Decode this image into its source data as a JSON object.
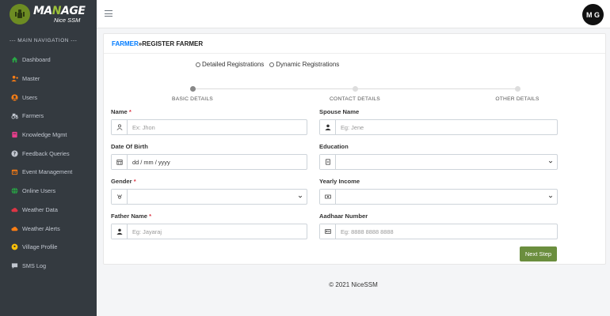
{
  "brand": {
    "title_a": "MA",
    "title_hl": "N",
    "title_b": "AGE",
    "subtitle": "Nice SSM"
  },
  "sidebar": {
    "heading": "--- MAIN NAVIGATION ---",
    "items": [
      {
        "label": "Dashboard",
        "icon": "home-icon",
        "color": "#28a745"
      },
      {
        "label": "Master",
        "icon": "user-plus-icon",
        "color": "#fd7e14"
      },
      {
        "label": "Users",
        "icon": "user-circle-icon",
        "color": "#fd7e14"
      },
      {
        "label": "Farmers",
        "icon": "tractor-icon",
        "color": "#c2c7d0"
      },
      {
        "label": "Knowledge Mgmt",
        "icon": "book-icon",
        "color": "#e83e8c"
      },
      {
        "label": "Feedback Queries",
        "icon": "question-icon",
        "color": "#c2c7d0"
      },
      {
        "label": "Event Management",
        "icon": "calendar-icon",
        "color": "#fd7e14"
      },
      {
        "label": "Online Users",
        "icon": "globe-icon",
        "color": "#28a745"
      },
      {
        "label": "Weather Data",
        "icon": "cloud-icon",
        "color": "#dc3545"
      },
      {
        "label": "Weather Alerts",
        "icon": "cloud-alert-icon",
        "color": "#fd7e14"
      },
      {
        "label": "Village Profile",
        "icon": "map-pin-icon",
        "color": "#ffc107"
      },
      {
        "label": "SMS Log",
        "icon": "message-icon",
        "color": "#c2c7d0"
      }
    ]
  },
  "topbar": {
    "avatar_initials": "M G"
  },
  "breadcrumb": {
    "link": "FARMER",
    "separator": " »",
    "current": "REGISTER FARMER"
  },
  "registration_type": {
    "options": [
      "Detailed Registrations",
      "Dynamic Registrations"
    ]
  },
  "steps": [
    "BASIC DETAILS",
    "CONTACT DETAILS",
    "OTHER DETAILS"
  ],
  "form": {
    "name": {
      "label": "Name",
      "required": "*",
      "placeholder": "Ex: Jhon"
    },
    "spouse_name": {
      "label": "Spouse Name",
      "placeholder": "Eg: Jene"
    },
    "dob": {
      "label": "Date Of Birth",
      "value": "dd / mm / yyyy"
    },
    "education": {
      "label": "Education"
    },
    "gender": {
      "label": "Gender",
      "required": "*"
    },
    "yearly_income": {
      "label": "Yearly Income"
    },
    "father_name": {
      "label": "Father Name",
      "required": "*",
      "placeholder": "Eg: Jayaraj"
    },
    "aadhaar": {
      "label": "Aadhaar Number",
      "placeholder": "Eg: 8888 8888 8888"
    }
  },
  "buttons": {
    "next": "Next Step"
  },
  "footer": {
    "text": "© 2021 NiceSSM"
  }
}
